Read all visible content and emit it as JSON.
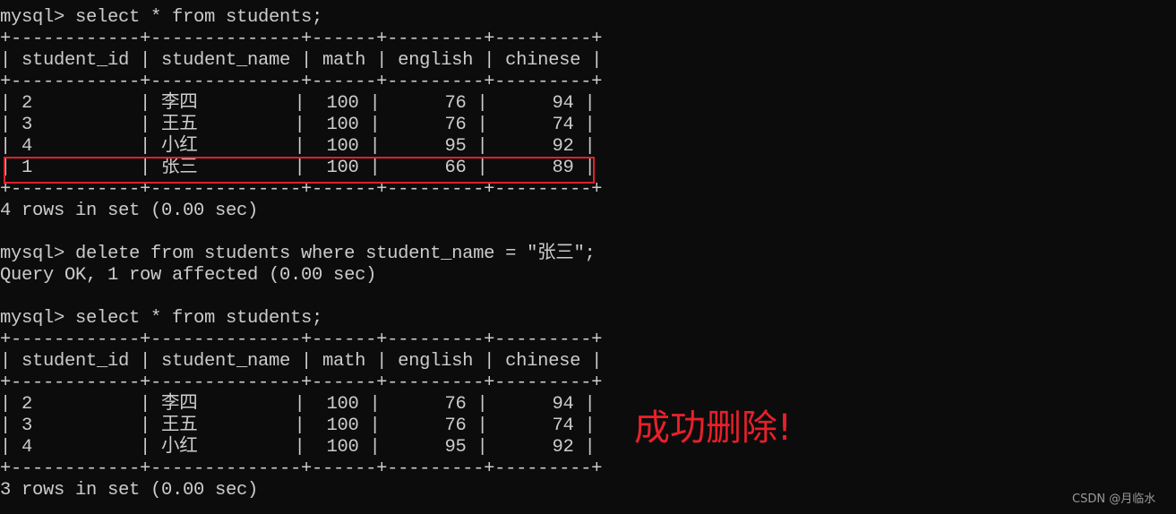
{
  "terminal": {
    "lines": [
      "mysql> select * from students;",
      "+------------+--------------+------+---------+---------+",
      "| student_id | student_name | math | english | chinese |",
      "+------------+--------------+------+---------+---------+",
      "| 2          | 李四         |  100 |      76 |      94 |",
      "| 3          | 王五         |  100 |      76 |      74 |",
      "| 4          | 小红         |  100 |      95 |      92 |",
      "| 1          | 张三         |  100 |      66 |      89 |",
      "+------------+--------------+------+---------+---------+",
      "4 rows in set (0.00 sec)",
      "",
      "mysql> delete from students where student_name = \"张三\";",
      "Query OK, 1 row affected (0.00 sec)",
      "",
      "mysql> select * from students;",
      "+------------+--------------+------+---------+---------+",
      "| student_id | student_name | math | english | chinese |",
      "+------------+--------------+------+---------+---------+",
      "| 2          | 李四         |  100 |      76 |      94 |",
      "| 3          | 王五         |  100 |      76 |      74 |",
      "| 4          | 小红         |  100 |      95 |      92 |",
      "+------------+--------------+------+---------+---------+",
      "3 rows in set (0.00 sec)"
    ]
  },
  "annotation": {
    "text": "成功删除!",
    "color": "#e8202a"
  },
  "watermark": "CSDN @月临水"
}
